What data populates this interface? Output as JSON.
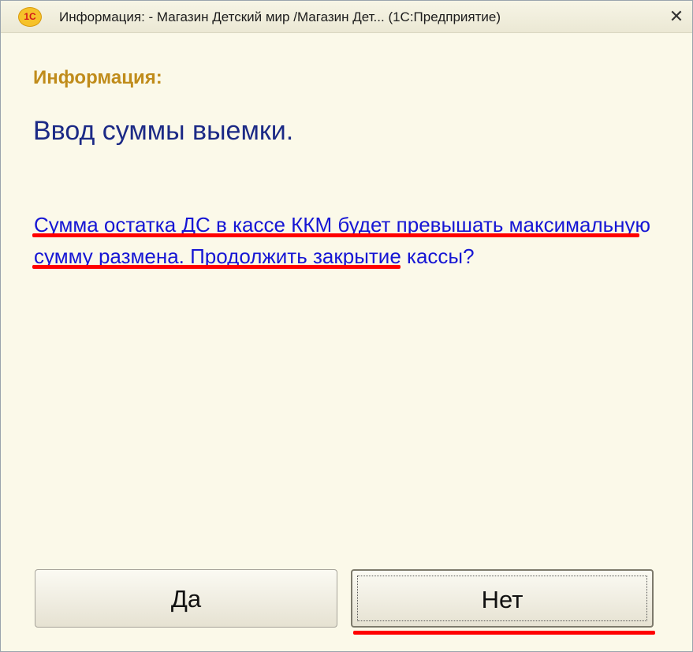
{
  "window": {
    "app_logo_text": "1C",
    "title": "Информация: - Магазин Детский мир /Магазин Дет... (1С:Предприятие)",
    "close_glyph": "✕"
  },
  "dialog": {
    "info_label": "Информация:",
    "main_text": "Ввод суммы выемки.",
    "message": "Сумма остатка ДС в кассе ККМ будет превышать максимальную сумму размена. Продолжить закрытие кассы?"
  },
  "buttons": {
    "yes_label": "Да",
    "no_label": "Нет"
  },
  "colors": {
    "background": "#fbf9e9",
    "info_label": "#c08c1b",
    "main_text": "#1c2a86",
    "message_text": "#1616d4",
    "annotation": "#ff0000"
  }
}
